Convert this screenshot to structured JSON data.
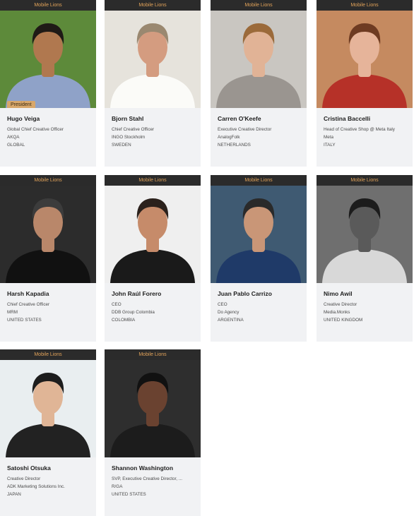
{
  "cards": [
    {
      "category": "Mobile Lions",
      "name": "Hugo Veiga",
      "title": "Global Chief Creative Officer",
      "company": "AKQA",
      "country": "GLOBAL",
      "badge": "President",
      "photo": {
        "bg": "#5d8a3a",
        "skin": "#b0784f",
        "hair": "#1f1a16",
        "shirt": "#8fa2c8"
      }
    },
    {
      "category": "Mobile Lions",
      "name": "Bjorn Stahl",
      "title": "Chief Creative Officer",
      "company": "INGO Stockholm",
      "country": "SWEDEN",
      "photo": {
        "bg": "#e6e3dc",
        "skin": "#d49c80",
        "hair": "#9a8870",
        "shirt": "#fbfbf8"
      }
    },
    {
      "category": "Mobile Lions",
      "name": "Carren O'Keefe",
      "title": "Executive Creative Director",
      "company": "AnalogFolk",
      "country": "NETHERLANDS",
      "photo": {
        "bg": "#c9c6c1",
        "skin": "#e1b396",
        "hair": "#9b6a3a",
        "shirt": "#9a9590"
      }
    },
    {
      "category": "Mobile Lions",
      "name": "Cristina Baccelli",
      "title": "Head of Creative Shop @ Meta Italy",
      "company": "Meta",
      "country": "ITALY",
      "photo": {
        "bg": "#c58a60",
        "skin": "#e6b49a",
        "hair": "#6e3b22",
        "shirt": "#b63128"
      }
    },
    {
      "category": "Mobile Lions",
      "name": "Harsh Kapadia",
      "title": "Chief Creative Officer",
      "company": "MRM",
      "country": "UNITED STATES",
      "photo": {
        "bg": "#2c2c2c",
        "skin": "#b9876a",
        "hair": "#3c3c3c",
        "shirt": "#111111"
      }
    },
    {
      "category": "Mobile Lions",
      "name": "John Raúl Forero",
      "title": "CEO",
      "company": "DDB Group Colombia",
      "country": "COLOMBIA",
      "photo": {
        "bg": "#efefef",
        "skin": "#c68b6a",
        "hair": "#2b211c",
        "shirt": "#1a1a1a"
      }
    },
    {
      "category": "Mobile Lions",
      "name": "Juan Pablo Carrizo",
      "title": "CEO",
      "company": "Do Agency",
      "country": "ARGENTINA",
      "photo": {
        "bg": "#3f5a72",
        "skin": "#c99677",
        "hair": "#2a2a2a",
        "shirt": "#1f3a68"
      }
    },
    {
      "category": "Mobile Lions",
      "name": "Nimo Awil",
      "title": "Creative Director",
      "company": "Media.Monks",
      "country": "UNITED KINGDOM",
      "photo": {
        "bg": "#6f6f6f",
        "skin": "#5a5a5a",
        "hair": "#1c1c1c",
        "shirt": "#d8d8d8"
      }
    },
    {
      "category": "Mobile Lions",
      "name": "Satoshi Otsuka",
      "title": "Creative Director",
      "company": "ADK Marketing Solutions Inc.",
      "country": "JAPAN",
      "photo": {
        "bg": "#e9eef0",
        "skin": "#e0b596",
        "hair": "#1d1d1d",
        "shirt": "#222222"
      }
    },
    {
      "category": "Mobile Lions",
      "name": "Shannon Washington",
      "title": "SVP, Executive Creative Director, ...",
      "company": "R/GA",
      "country": "UNITED STATES",
      "photo": {
        "bg": "#2e2e2e",
        "skin": "#6a4230",
        "hair": "#111111",
        "shirt": "#1c1c1c"
      }
    }
  ]
}
